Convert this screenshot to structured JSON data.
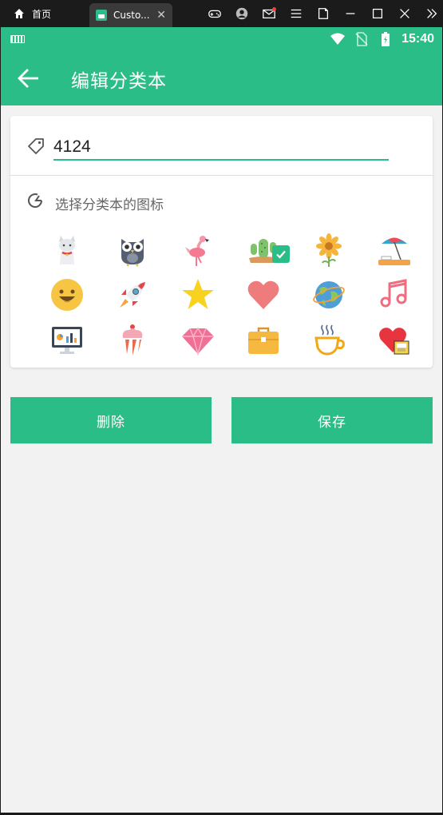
{
  "window": {
    "home_tab_label": "首页",
    "app_tab_label": "Custo...",
    "tab_close": "✕"
  },
  "status": {
    "time": "15:40"
  },
  "app_bar": {
    "title": "编辑分类本"
  },
  "form": {
    "name_value": "4124",
    "icon_section_label": "选择分类本的图标",
    "icons": [
      "cat",
      "owl",
      "flamingo",
      "cactus",
      "sunflower",
      "beach-umbrella",
      "smiley",
      "rocket",
      "star",
      "heart",
      "earth",
      "music-note",
      "monitor",
      "cupcake",
      "gem",
      "briefcase",
      "coffee-cup",
      "heart-gift"
    ],
    "selected_icon": "cactus"
  },
  "actions": {
    "delete_label": "删除",
    "save_label": "保存"
  },
  "colors": {
    "accent": "#2bbd87",
    "background": "#f2f2f2"
  }
}
